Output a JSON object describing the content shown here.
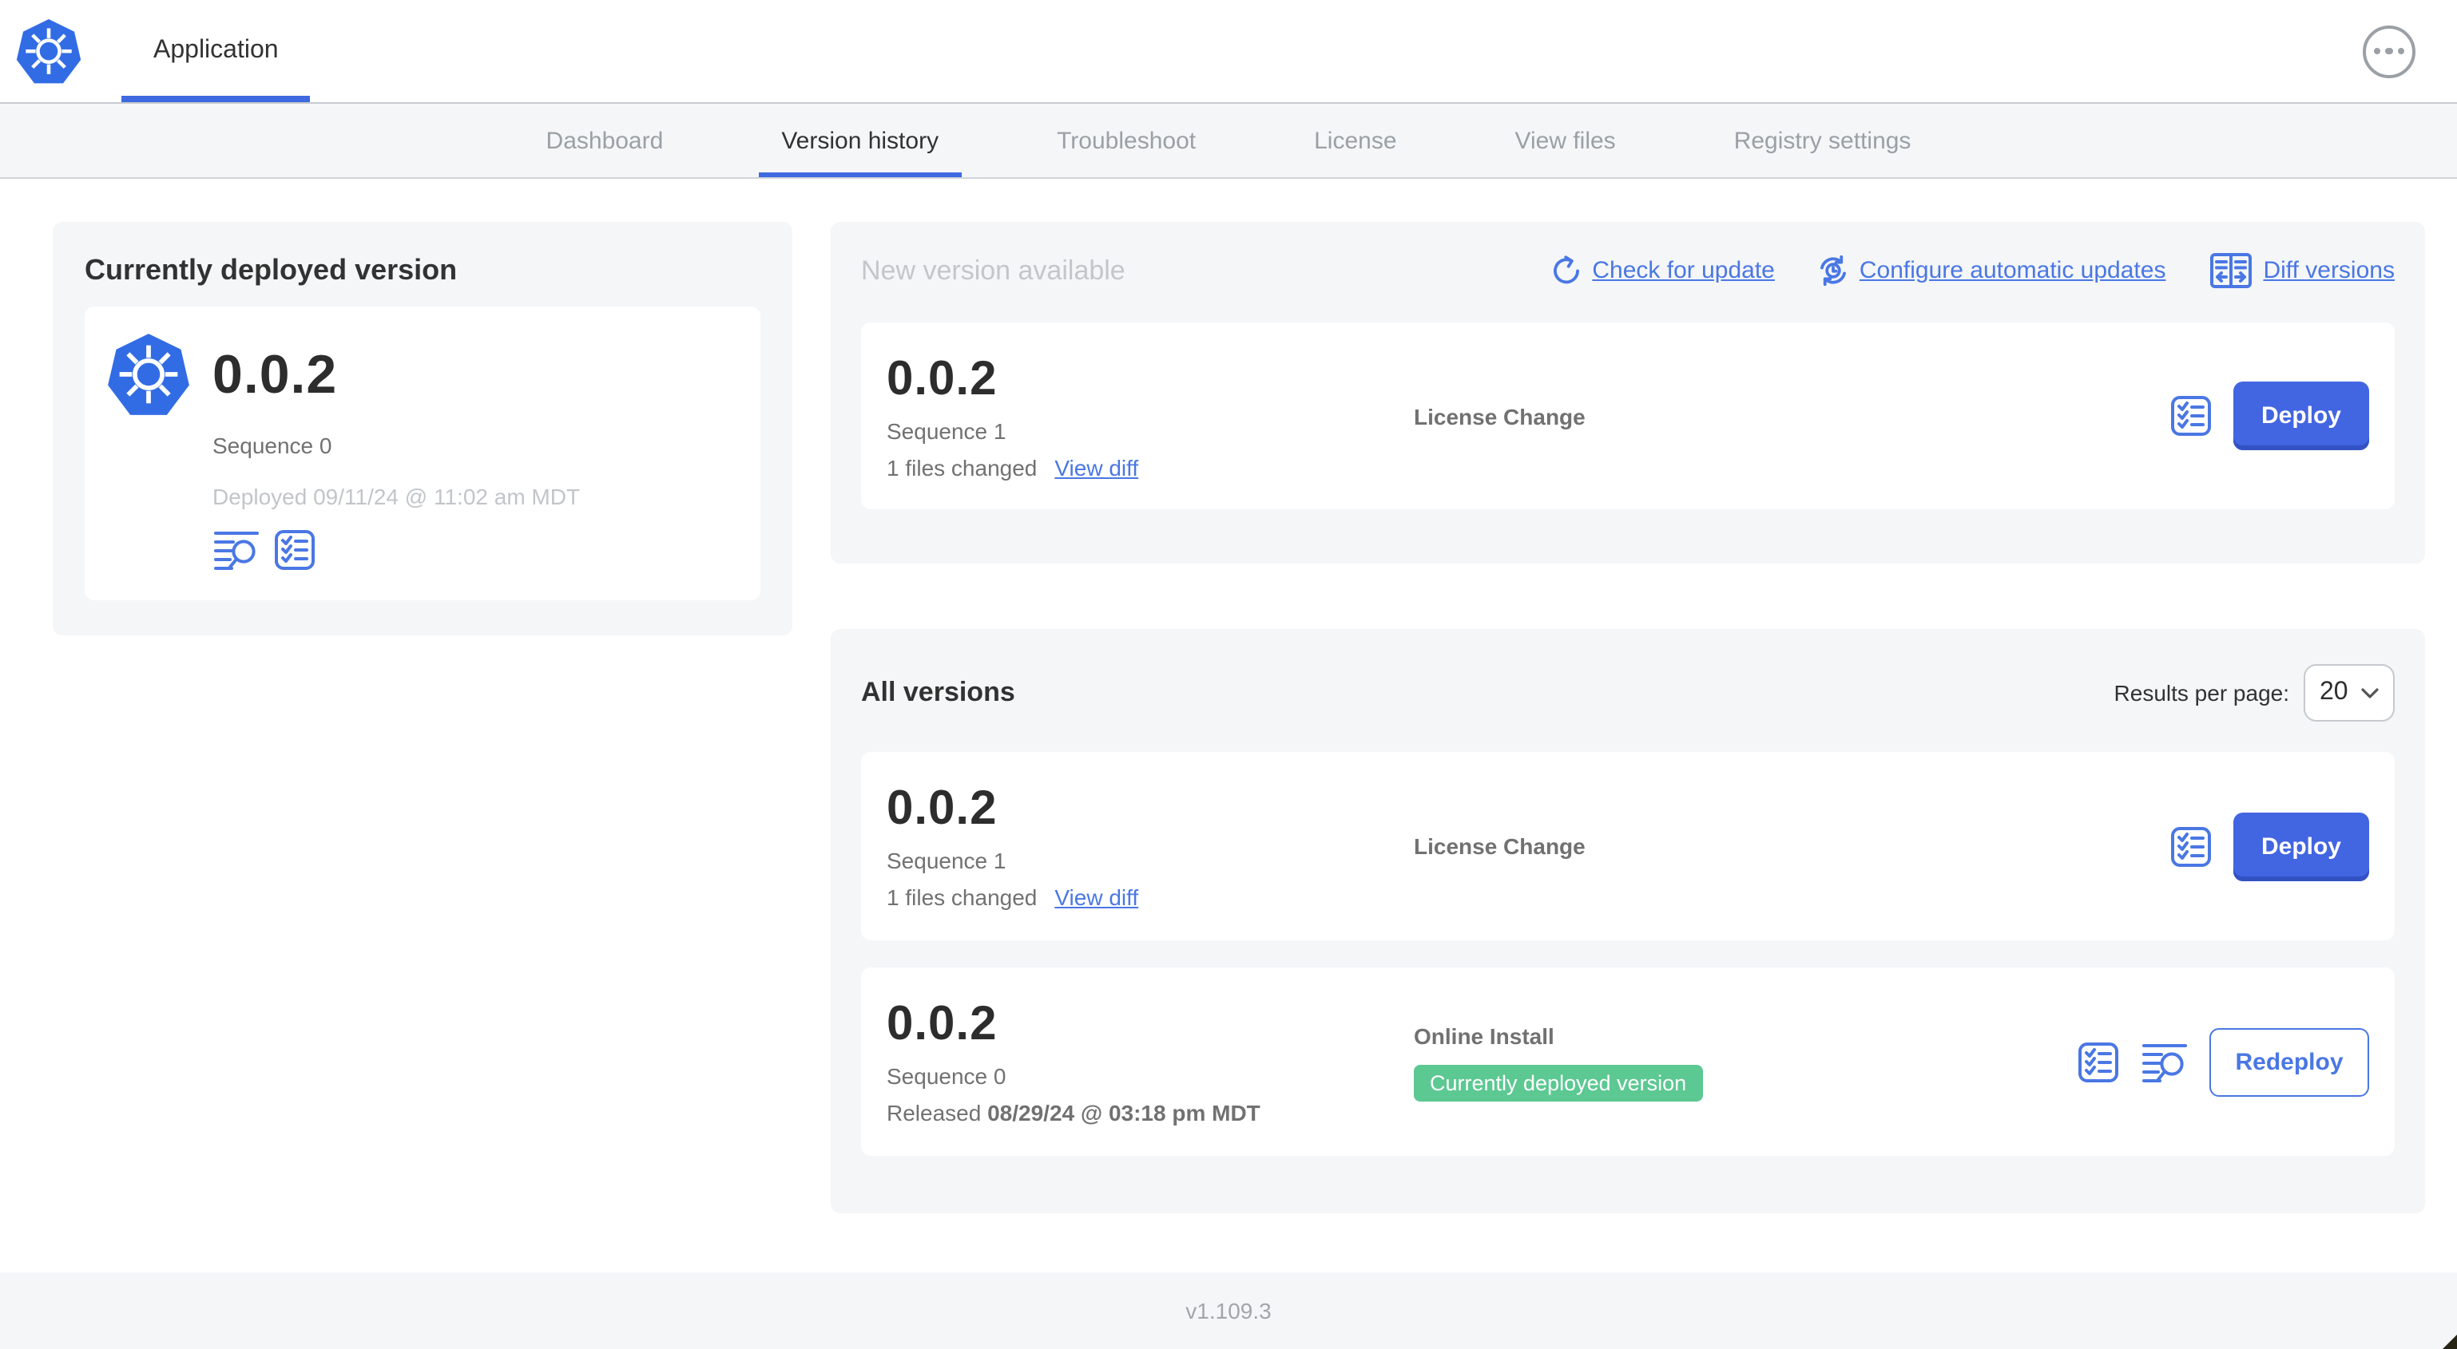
{
  "colors": {
    "accent": "#3e69e0",
    "link": "#4a77e4",
    "primary_button": "#4265e2",
    "badge_green": "#5cc892",
    "k8s_logo_blue": "#326ce5"
  },
  "header": {
    "app_tab": "Application",
    "menu_icon": "ellipsis-menu-icon"
  },
  "nav": {
    "tabs": [
      "Dashboard",
      "Version history",
      "Troubleshoot",
      "License",
      "View files",
      "Registry settings"
    ],
    "active_tab": "Version history"
  },
  "currently_deployed": {
    "title": "Currently deployed version",
    "version": "0.0.2",
    "sequence": "Sequence 0",
    "deployed": "Deployed 09/11/24 @ 11:02 am MDT",
    "icons": [
      "logs-icon",
      "preflight-checklist-icon"
    ]
  },
  "new_version": {
    "title": "New version available",
    "actions": [
      {
        "label": "Check for update",
        "icon": "refresh-icon"
      },
      {
        "label": "Configure automatic updates",
        "icon": "scheduled-update-icon"
      },
      {
        "label": "Diff versions",
        "icon": "diff-icon"
      }
    ],
    "card": {
      "version": "0.0.2",
      "sequence": "Sequence 1",
      "files_changed": "1 files changed",
      "view_diff_label": "View diff",
      "source": "License Change",
      "deploy_label": "Deploy"
    }
  },
  "all_versions": {
    "title": "All versions",
    "results_per_page_label": "Results per page:",
    "results_per_page_value": "20",
    "rows": [
      {
        "version": "0.0.2",
        "sequence": "Sequence 1",
        "files_changed": "1 files changed",
        "view_diff_label": "View diff",
        "source": "License Change",
        "action_label": "Deploy"
      },
      {
        "version": "0.0.2",
        "sequence": "Sequence 0",
        "released_prefix": "Released",
        "released_date": "08/29/24 @ 03:18 pm MDT",
        "source": "Online Install",
        "badge": "Currently deployed version",
        "action_label": "Redeploy"
      }
    ]
  },
  "footer": {
    "version": "v1.109.3"
  }
}
